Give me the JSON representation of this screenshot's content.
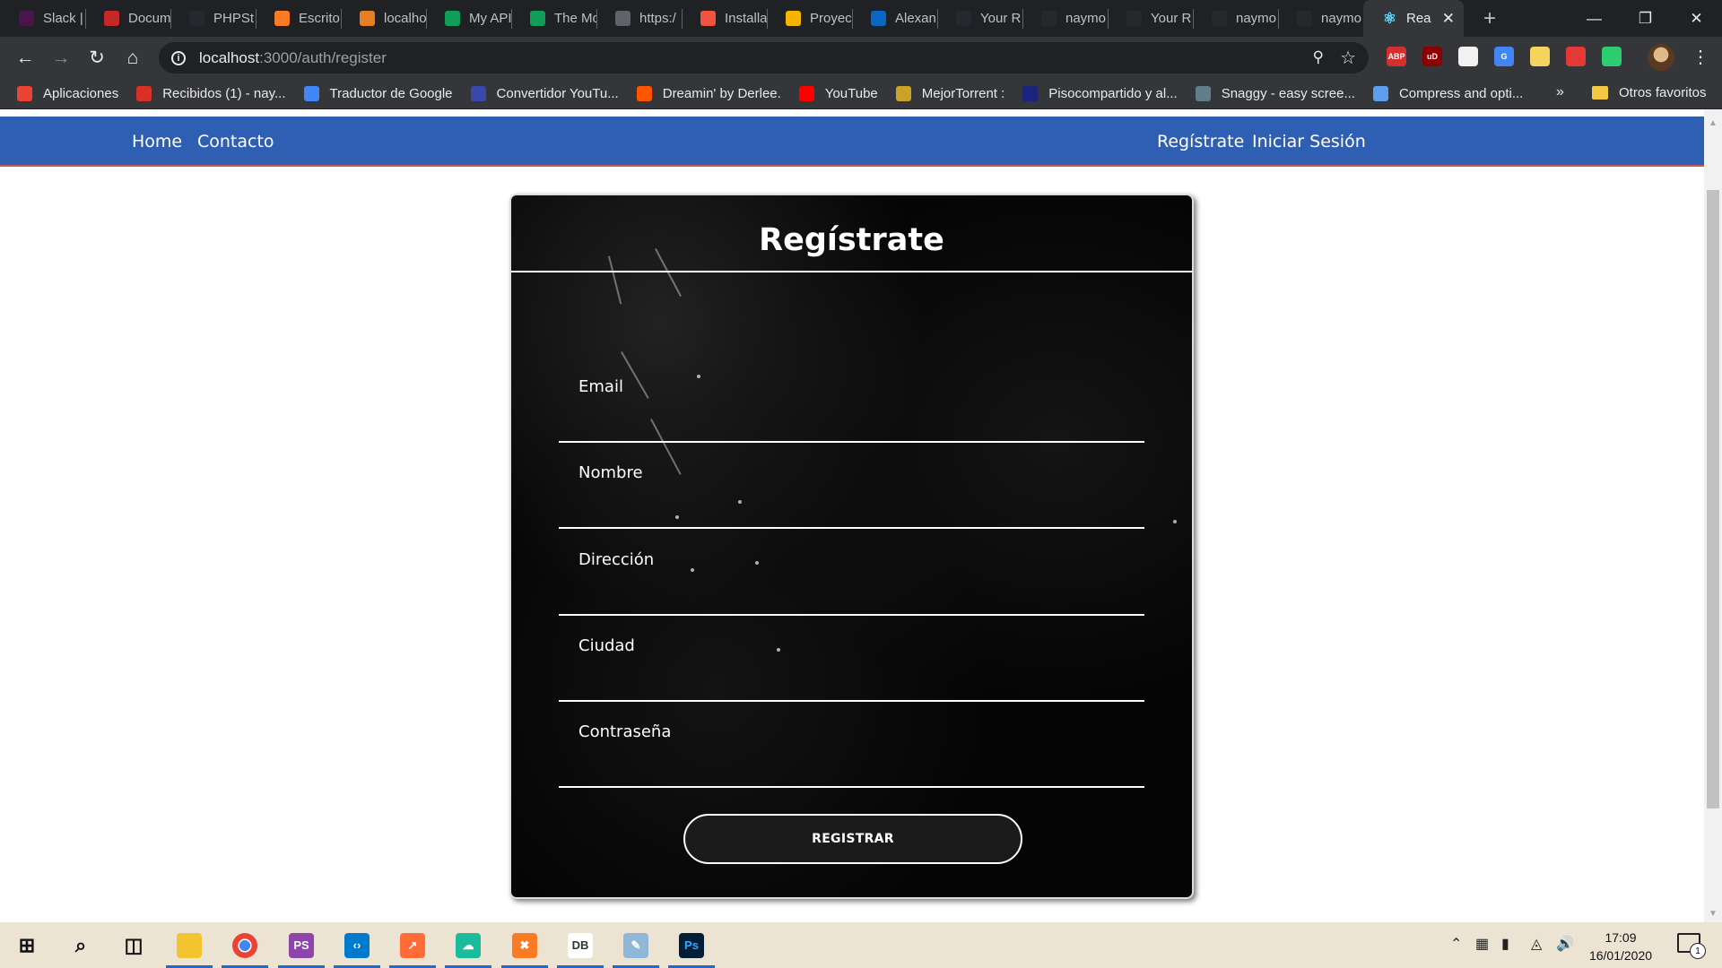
{
  "browser": {
    "tabs": [
      {
        "title": "Slack |",
        "icon": "slack-icon",
        "color": "#4a154b"
      },
      {
        "title": "Docum",
        "icon": "pdf-icon",
        "color": "#c62828"
      },
      {
        "title": "PHPSt",
        "icon": "github-icon",
        "color": "#24292e"
      },
      {
        "title": "Escrito",
        "icon": "xampp-icon",
        "color": "#fb7a24"
      },
      {
        "title": "localho",
        "icon": "mountain-icon",
        "color": "#e67e22"
      },
      {
        "title": "My API",
        "icon": "doc-icon",
        "color": "#0f9d58"
      },
      {
        "title": "The Mo",
        "icon": "doc-icon",
        "color": "#0f9d58"
      },
      {
        "title": "https:/",
        "icon": "globe-icon",
        "color": "#5f6368"
      },
      {
        "title": "Installa",
        "icon": "laravel-icon",
        "color": "#f05340"
      },
      {
        "title": "Proyec",
        "icon": "slides-icon",
        "color": "#f4b400"
      },
      {
        "title": "Alexan",
        "icon": "linkedin-icon",
        "color": "#0a66c2"
      },
      {
        "title": "Your R",
        "icon": "github-icon",
        "color": "#24292e"
      },
      {
        "title": "naymo",
        "icon": "github-icon",
        "color": "#24292e"
      },
      {
        "title": "Your R",
        "icon": "github-icon",
        "color": "#24292e"
      },
      {
        "title": "naymo",
        "icon": "github-icon",
        "color": "#24292e"
      },
      {
        "title": "naymo",
        "icon": "github-icon",
        "color": "#24292e"
      }
    ],
    "active_tab": {
      "title": "Rea",
      "icon": "react-icon",
      "color": "#61dafb"
    },
    "url_host": "localhost",
    "url_rest": ":3000/auth/register",
    "extensions": [
      {
        "name": "adblock-icon",
        "label": "ABP",
        "color": "#d32f2f"
      },
      {
        "name": "ublock-icon",
        "label": "uD",
        "color": "#8b0000"
      },
      {
        "name": "doc-extension-icon",
        "label": "",
        "color": "#f1f1f1"
      },
      {
        "name": "translate-icon",
        "label": "G",
        "color": "#4285f4"
      },
      {
        "name": "bulb-icon",
        "label": "",
        "color": "#f4d35e"
      },
      {
        "name": "puzzle-red-icon",
        "label": "",
        "color": "#e53935"
      },
      {
        "name": "circle-green-icon",
        "label": "",
        "color": "#2ecc71"
      }
    ],
    "bookmarks": [
      {
        "label": "Aplicaciones",
        "icon": "apps-icon",
        "color": "#ea4335"
      },
      {
        "label": "Recibidos (1) - nay...",
        "icon": "gmail-icon",
        "color": "#d93025"
      },
      {
        "label": "Traductor de Google",
        "icon": "translate-icon",
        "color": "#4285f4"
      },
      {
        "label": "Convertidor YouTu...",
        "icon": "converter-icon",
        "color": "#3949ab"
      },
      {
        "label": "Dreamin' by Derlee.",
        "icon": "soundcloud-icon",
        "color": "#ff5500"
      },
      {
        "label": "YouTube",
        "icon": "youtube-icon",
        "color": "#ff0000"
      },
      {
        "label": "MejorTorrent :",
        "icon": "torrent-icon",
        "color": "#c9a227"
      },
      {
        "label": "Pisocompartido y al...",
        "icon": "piso-icon",
        "color": "#1a237e"
      },
      {
        "label": "Snaggy - easy scree...",
        "icon": "snaggy-icon",
        "color": "#607d8b"
      },
      {
        "label": "Compress and opti...",
        "icon": "compress-icon",
        "color": "#5c9ded"
      }
    ],
    "bookmarks_more": "»",
    "other_bookmarks": "Otros favoritos"
  },
  "site_nav": {
    "left": [
      "Home",
      "Contacto"
    ],
    "right": [
      "Regístrate",
      "Iniciar Sesión"
    ],
    "color": "#2e5fb3"
  },
  "register": {
    "title": "Regístrate",
    "fields": [
      {
        "label": "Email",
        "value": ""
      },
      {
        "label": "Nombre",
        "value": ""
      },
      {
        "label": "Dirección",
        "value": ""
      },
      {
        "label": "Ciudad",
        "value": ""
      },
      {
        "label": "Contraseña",
        "value": ""
      }
    ],
    "submit": "REGISTRAR"
  },
  "taskbar": {
    "apps": [
      {
        "name": "start-icon",
        "running": false
      },
      {
        "name": "search-icon",
        "running": false
      },
      {
        "name": "task-view-icon",
        "running": false
      },
      {
        "name": "file-explorer-icon",
        "running": true
      },
      {
        "name": "chrome-icon",
        "running": true
      },
      {
        "name": "phpstorm-icon",
        "running": true
      },
      {
        "name": "vscode-icon",
        "running": true
      },
      {
        "name": "postman-icon",
        "running": true
      },
      {
        "name": "gitkraken-icon",
        "running": true
      },
      {
        "name": "xampp-icon",
        "running": true
      },
      {
        "name": "dbeaver-icon",
        "running": true
      },
      {
        "name": "notes-icon",
        "running": true
      },
      {
        "name": "photoshop-icon",
        "running": true
      }
    ],
    "time": "17:09",
    "date": "16/01/2020",
    "notifications": "1"
  }
}
